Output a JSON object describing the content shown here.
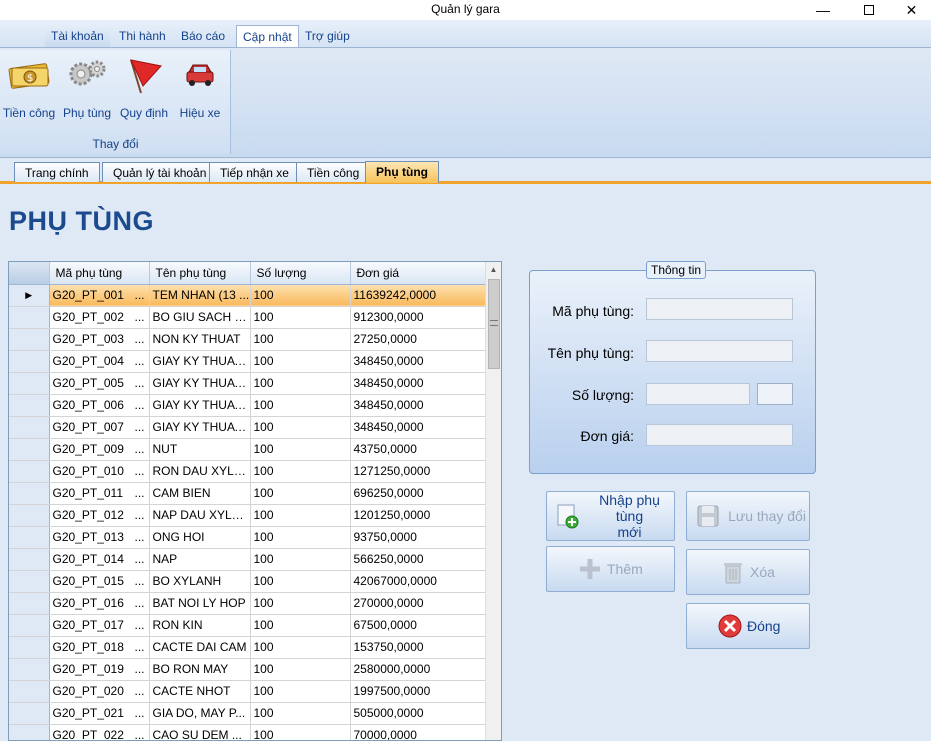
{
  "window": {
    "title": "Quản lý gara",
    "minimize": "—",
    "close": "✕"
  },
  "ribbon": {
    "tabs": [
      {
        "label": "Tài khoản"
      },
      {
        "label": "Thi hành"
      },
      {
        "label": "Báo cáo"
      },
      {
        "label": "Cập nhật"
      },
      {
        "label": "Trợ giúp"
      }
    ],
    "group_label": "Thay đổi",
    "buttons": [
      {
        "label": "Tiền công",
        "icon": "money-icon"
      },
      {
        "label": "Phụ tùng",
        "icon": "gears-icon"
      },
      {
        "label": "Quy định",
        "icon": "flag-icon"
      },
      {
        "label": "Hiệu xe",
        "icon": "car-icon"
      }
    ]
  },
  "doc_tabs": [
    {
      "label": "Trang chính"
    },
    {
      "label": "Quản lý tài khoản"
    },
    {
      "label": "Tiếp nhận xe"
    },
    {
      "label": "Tiền công"
    },
    {
      "label": "Phụ tùng"
    }
  ],
  "page_title": "PHỤ TÙNG",
  "grid": {
    "columns": [
      "Mã phụ tùng",
      "Tên phụ tùng",
      "Số lượng",
      "Đơn giá"
    ],
    "ellipsis": "...",
    "rows": [
      [
        "G20_PT_001",
        "TEM NHAN (13 ...",
        "100",
        "11639242,0000"
      ],
      [
        "G20_PT_002",
        "BO GIU SACH XE",
        "100",
        "912300,0000"
      ],
      [
        "G20_PT_003",
        "NON KY THUAT",
        "100",
        "27250,0000"
      ],
      [
        "G20_PT_004",
        "GIAY KY THUAT...",
        "100",
        "348450,0000"
      ],
      [
        "G20_PT_005",
        "GIAY KY THUAT...",
        "100",
        "348450,0000"
      ],
      [
        "G20_PT_006",
        "GIAY KY THUAT...",
        "100",
        "348450,0000"
      ],
      [
        "G20_PT_007",
        "GIAY KY THUAT...",
        "100",
        "348450,0000"
      ],
      [
        "G20_PT_009",
        "NUT",
        "100",
        "43750,0000"
      ],
      [
        "G20_PT_010",
        "RON DAU XYLA...",
        "100",
        "1271250,0000"
      ],
      [
        "G20_PT_011",
        "CAM BIEN",
        "100",
        "696250,0000"
      ],
      [
        "G20_PT_012",
        "NAP DAU XYLA...",
        "100",
        "1201250,0000"
      ],
      [
        "G20_PT_013",
        "ONG HOI",
        "100",
        "93750,0000"
      ],
      [
        "G20_PT_014",
        "NAP",
        "100",
        "566250,0000"
      ],
      [
        "G20_PT_015",
        "BO XYLANH",
        "100",
        "42067000,0000"
      ],
      [
        "G20_PT_016",
        "BAT NOI LY HOP",
        "100",
        "270000,0000"
      ],
      [
        "G20_PT_017",
        "RON KIN",
        "100",
        "67500,0000"
      ],
      [
        "G20_PT_018",
        "CACTE DAI CAM",
        "100",
        "153750,0000"
      ],
      [
        "G20_PT_019",
        "BO RON MAY",
        "100",
        "2580000,0000"
      ],
      [
        "G20_PT_020",
        "CACTE NHOT",
        "100",
        "1997500,0000"
      ],
      [
        "G20_PT_021",
        "GIA DO, MAY P...",
        "100",
        "505000,0000"
      ],
      [
        "G20_PT_022",
        "CAO SU DEM ...",
        "100",
        "70000,0000"
      ]
    ]
  },
  "info": {
    "title": "Thông tin",
    "ma_label": "Mã phụ tùng:",
    "ten_label": "Tên phụ tùng:",
    "soluong_label": "Số lượng:",
    "dongia_label": "Đơn giá:"
  },
  "buttons": {
    "nhap_line1": "Nhập phụ tùng",
    "nhap_line2": "mới",
    "luu": "Lưu thay đổi",
    "them": "Thêm",
    "xoa": "Xóa",
    "dong": "Đóng"
  }
}
